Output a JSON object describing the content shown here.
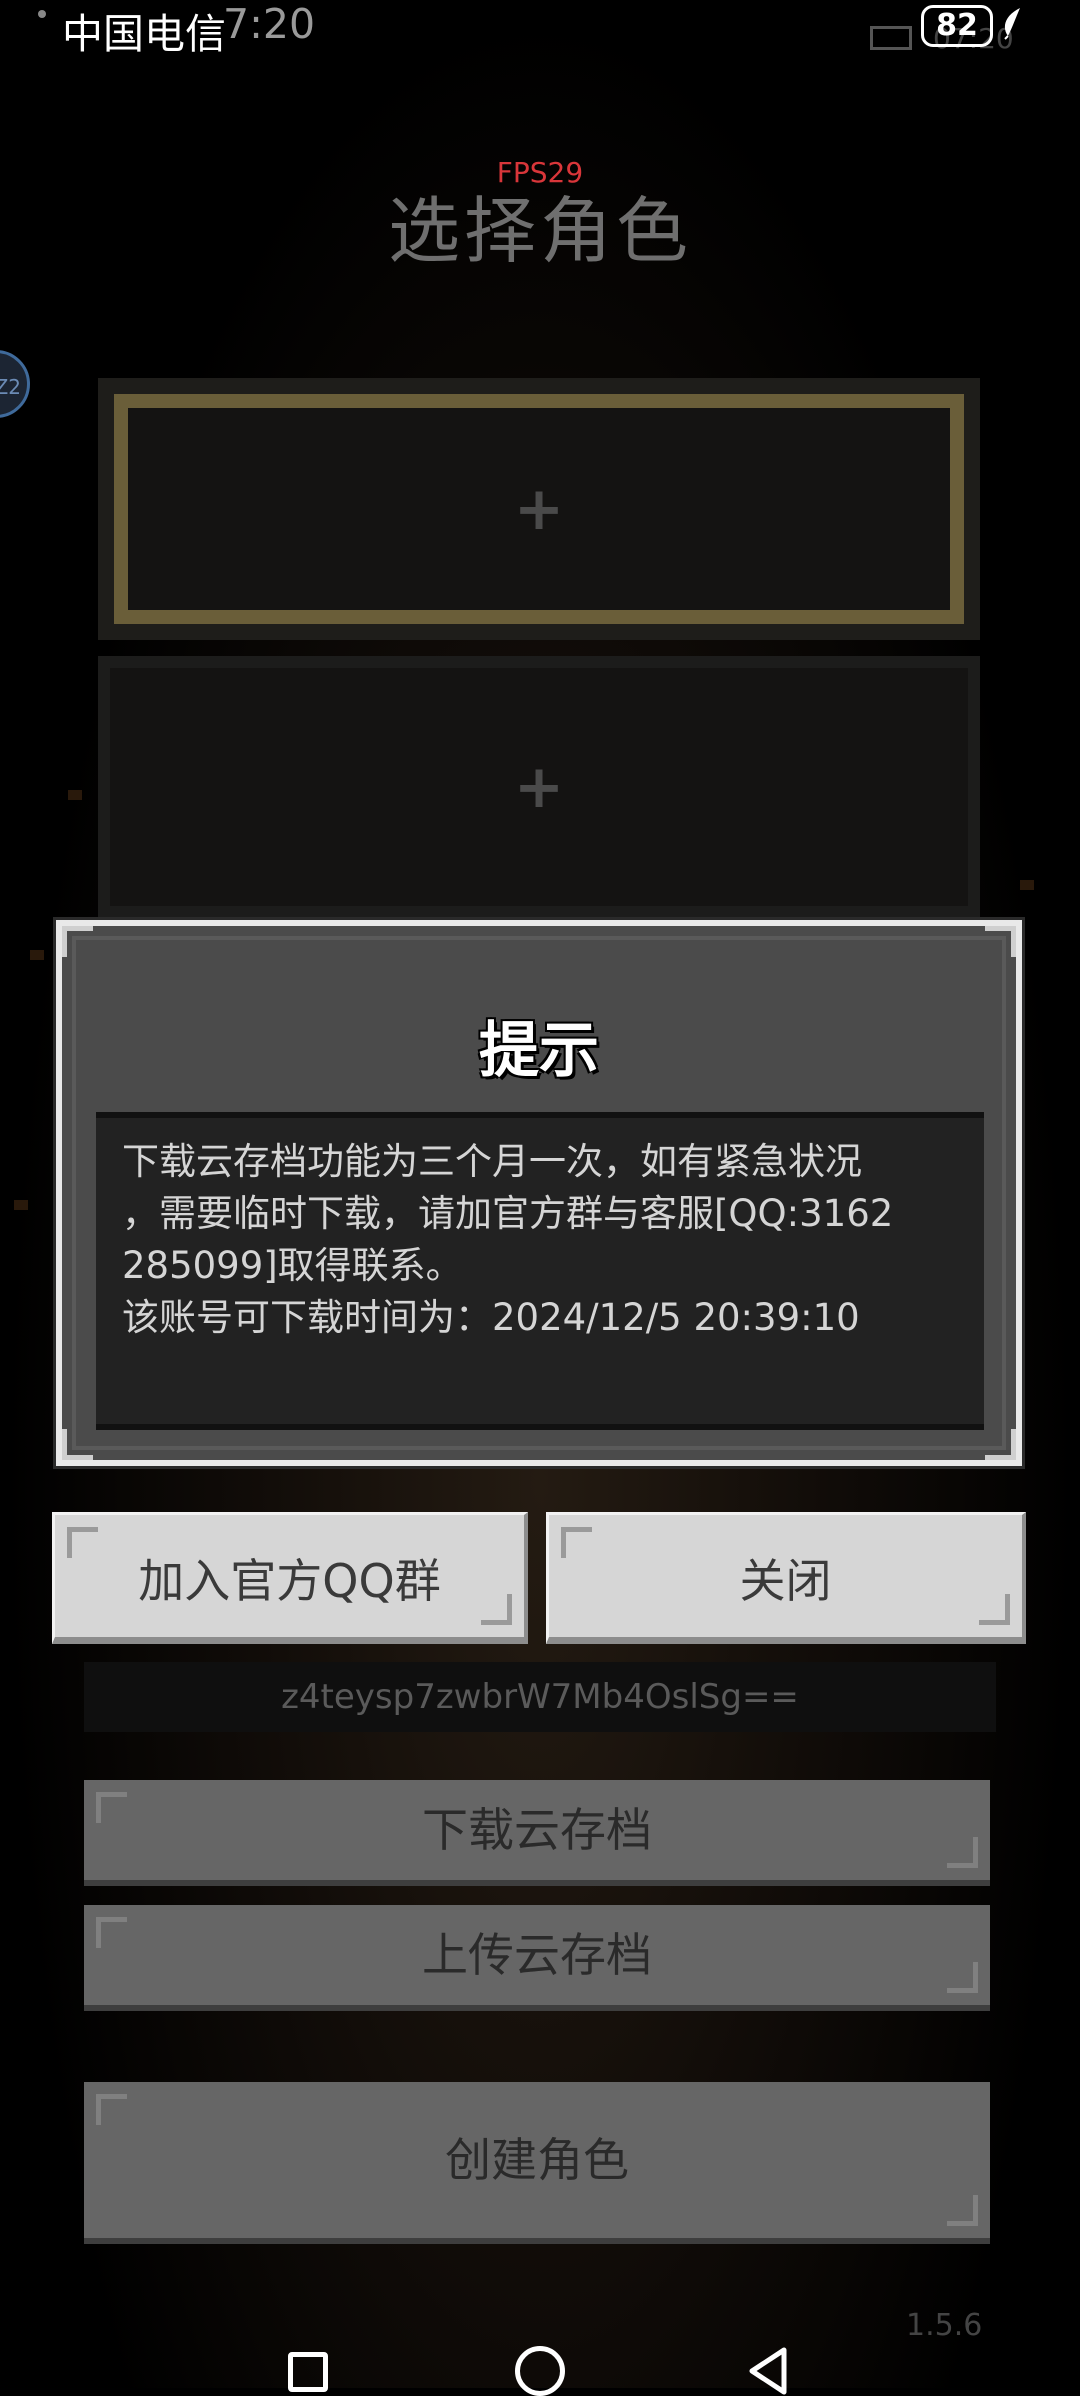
{
  "status_bar": {
    "carrier": "中国电信",
    "time": "7:20",
    "ghost_clock": "07:20",
    "battery_level": "82"
  },
  "header": {
    "fps": "FPS29",
    "title": "选择角色"
  },
  "avatar_text": "Z2",
  "slots": [
    {
      "icon": "+"
    },
    {
      "icon": "+"
    }
  ],
  "dialog": {
    "title": "提示",
    "message_lines": [
      "下载云存档功能为三个月一次，如有紧急状况",
      "，需要临时下载，请加官方群与客服[QQ:3162",
      "285099]取得联系。",
      "该账号可下载时间为：2024/12/5 20:39:10"
    ],
    "buttons": {
      "join_qq": "加入官方QQ群",
      "close": "关闭"
    }
  },
  "background": {
    "account_code": "z4teysp7zwbrW7Mb4OslSg==",
    "download_button": "下载云存档",
    "upload_button": "上传云存档",
    "create_button": "创建角色",
    "version": "1.5.6"
  }
}
